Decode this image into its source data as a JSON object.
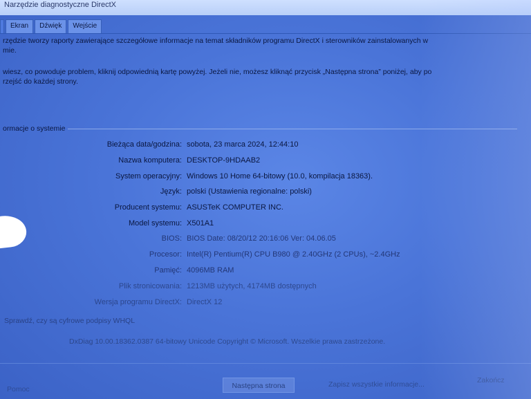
{
  "window": {
    "title": "Narzędzie diagnostyczne DirectX"
  },
  "tabs": [
    "",
    "Ekran",
    "Dźwięk",
    "Wejście"
  ],
  "intro": {
    "line1": "rzędzie tworzy raporty zawierające szczegółowe informacje na temat składników programu DirectX i sterowników zainstalowanych w",
    "line1b": "mie.",
    "line2": " wiesz, co powoduje problem, kliknij odpowiednią kartę powyżej. Jeżeli nie, możesz kliknąć przycisk „Następna strona” poniżej, aby po",
    "line2b": "rzejść do każdej strony."
  },
  "system_info": {
    "title": "ormacje o systemie",
    "rows": [
      {
        "label": "Bieżąca data/godzina:",
        "value": "sobota, 23 marca 2024, 12:44:10"
      },
      {
        "label": "Nazwa komputera:",
        "value": "DESKTOP-9HDAAB2"
      },
      {
        "label": "System operacyjny:",
        "value": "Windows 10 Home 64-bitowy (10.0, kompilacja 18363)."
      },
      {
        "label": "Język:",
        "value": "polski (Ustawienia regionalne: polski)"
      },
      {
        "label": "Producent systemu:",
        "value": "ASUSTeK COMPUTER INC."
      },
      {
        "label": "Model systemu:",
        "value": "X501A1"
      },
      {
        "label": "BIOS:",
        "value": "BIOS Date: 08/20/12 20:16:06 Ver: 04.06.05"
      },
      {
        "label": "Procesor:",
        "value": "Intel(R) Pentium(R) CPU B980 @ 2.40GHz (2 CPUs), ~2.4GHz"
      },
      {
        "label": "Pamięć:",
        "value": "4096MB RAM"
      },
      {
        "label": "Plik stronicowania:",
        "value": "1213MB użytych, 4174MB dostępnych"
      },
      {
        "label": "Wersja programu DirectX:",
        "value": "DirectX 12"
      }
    ]
  },
  "whql": {
    "label": "Sprawdź, czy są cyfrowe podpisy WHQL"
  },
  "footer": {
    "copyright": "DxDiag 10.00.18362.0387 64-bitowy Unicode  Copyright © Microsoft. Wszelkie prawa zastrzeżone."
  },
  "buttons": {
    "help": "Pomoc",
    "next": "Następna strona",
    "save": "Zapisz wszystkie informacje...",
    "exit": "Zakończ"
  }
}
